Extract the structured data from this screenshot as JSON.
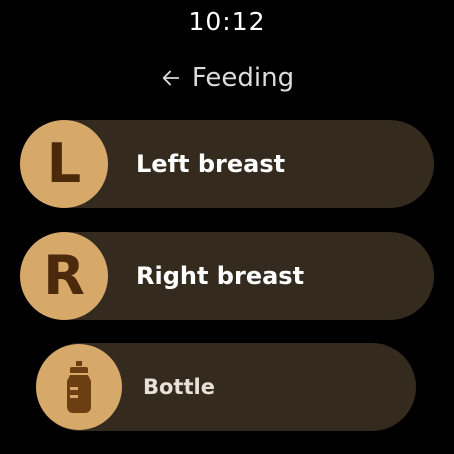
{
  "status": {
    "time": "10:12"
  },
  "header": {
    "title": "Feeding",
    "back_icon": "arrow-left-icon"
  },
  "options": [
    {
      "initial": "L",
      "label": "Left breast"
    },
    {
      "initial": "R",
      "label": "Right breast"
    },
    {
      "label": "Bottle",
      "icon": "baby-bottle-icon"
    }
  ],
  "colors": {
    "background": "#000000",
    "chip": "#342b1e",
    "avatar": "#d6a86a",
    "avatar_glyph": "#4b2a0b",
    "label": "#ffffff"
  }
}
